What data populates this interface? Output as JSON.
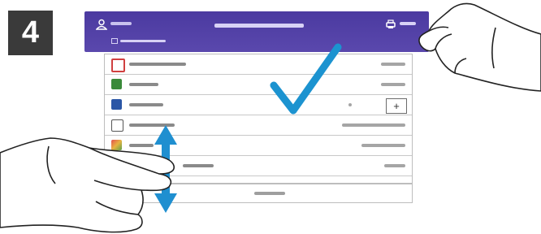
{
  "step": {
    "number": "4"
  },
  "colors": {
    "header": "#4b3aa0",
    "checkmark": "#1c93d0",
    "arrow": "#1f8fd0"
  },
  "icons": {
    "header_left": "user-icon",
    "header_right": "printer-icon",
    "check": "checkmark-icon",
    "scroll": "double-arrow-icon",
    "plus": "+"
  },
  "rows": [
    {
      "icon": "shield-icon",
      "color": "#d04040"
    },
    {
      "icon": "apps-icon",
      "color": "#3a8a3a"
    },
    {
      "icon": "square-icon",
      "color": "#2a56a6"
    },
    {
      "icon": "tray-icon",
      "color": "#555555"
    },
    {
      "icon": "image-icon",
      "color": "#e7b340"
    },
    {
      "icon": "none",
      "color": "#ffffff"
    }
  ]
}
